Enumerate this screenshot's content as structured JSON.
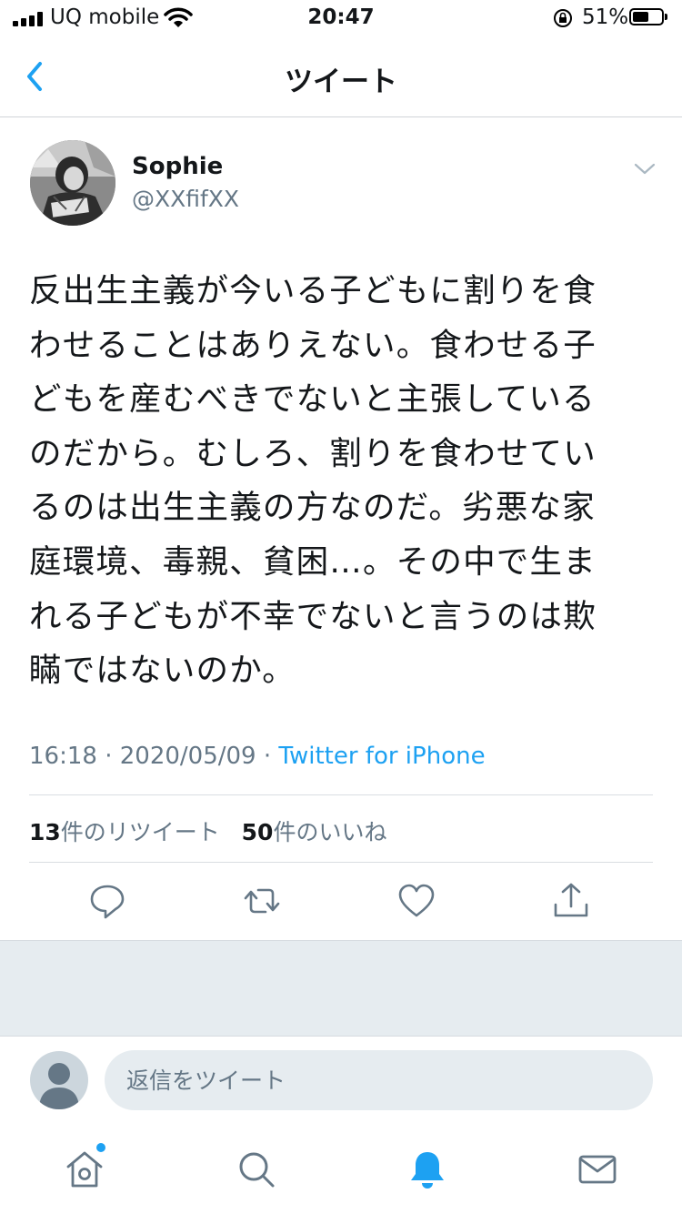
{
  "status_bar": {
    "carrier": "UQ mobile",
    "time": "20:47",
    "battery": "51%"
  },
  "header": {
    "title": "ツイート"
  },
  "tweet": {
    "name": "Sophie",
    "handle": "@XXfifXX",
    "lines": [
      "反出生主義が今いる子どもに割りを食",
      "わせることはありえない。食わせる子",
      "どもを産むべきでないと主張している",
      "のだから。むしろ、割りを食わせてい",
      "るのは出生主義の方なのだ。劣悪な家",
      "庭環境、毒親、貧困…。その中で生ま",
      "れる子どもが不幸でないと言うのは欺",
      "瞞ではないのか。"
    ],
    "time": "16:18",
    "sep1": " · ",
    "date": "2020/05/09",
    "sep2": " · ",
    "source": "Twitter for iPhone",
    "retweet_count": "13",
    "retweet_label": "件のリツイート",
    "like_count": "50",
    "like_label": "件のいいね"
  },
  "reply": {
    "placeholder": "返信をツイート"
  },
  "colors": {
    "accent": "#1da1f2",
    "secondary_text": "#657786",
    "filler": "#e6ecf0"
  },
  "icons": {
    "actions": [
      "reply-icon",
      "retweet-icon",
      "like-icon",
      "share-icon"
    ],
    "tabs": [
      "home-icon",
      "search-icon",
      "notifications-icon",
      "messages-icon"
    ]
  }
}
